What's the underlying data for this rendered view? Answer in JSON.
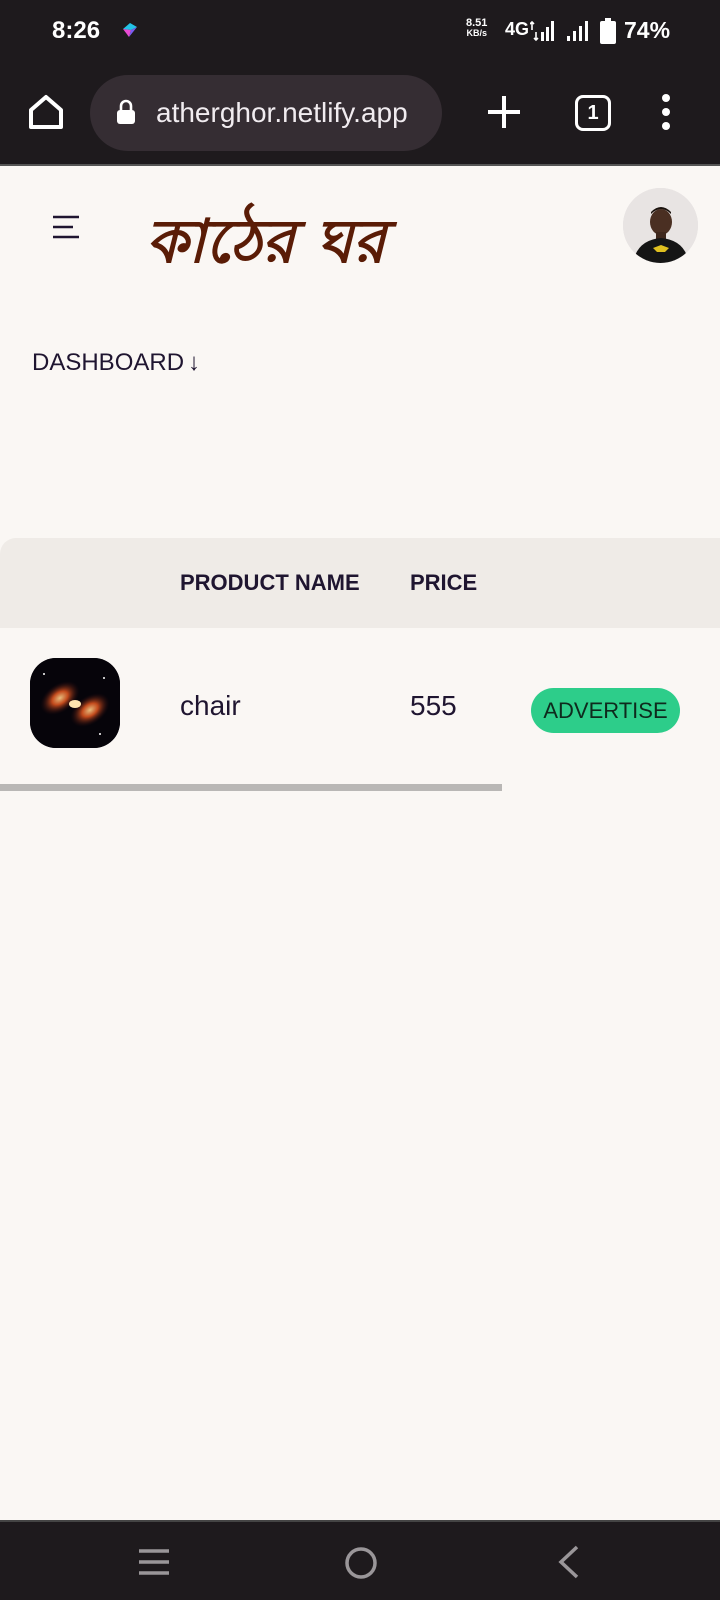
{
  "status_bar": {
    "time": "8:26",
    "net_speed_value": "8.51",
    "net_speed_unit": "KB/s",
    "network_type": "4G",
    "battery": "74%"
  },
  "browser": {
    "url": "atherghor.netlify.app",
    "tab_count": "1"
  },
  "site": {
    "logo": "কাঠের ঘর",
    "dashboard_label": "DASHBOARD",
    "dashboard_arrow": "↓"
  },
  "table": {
    "headers": {
      "product_name": "PRODUCT NAME",
      "price": "PRICE"
    },
    "rows": [
      {
        "name": "chair",
        "price": "555",
        "action": "ADVERTISE"
      }
    ]
  },
  "colors": {
    "brand": "#5a1c06",
    "accent": "#2dcd8a",
    "system_bar": "#1e1a1d",
    "page_bg": "#faf7f4"
  },
  "icons": [
    "home-icon",
    "lock-icon",
    "plus-icon",
    "tabs-icon",
    "more-vert-icon",
    "hamburger-icon",
    "avatar",
    "recent-apps-icon",
    "home-circle-icon",
    "back-icon"
  ]
}
